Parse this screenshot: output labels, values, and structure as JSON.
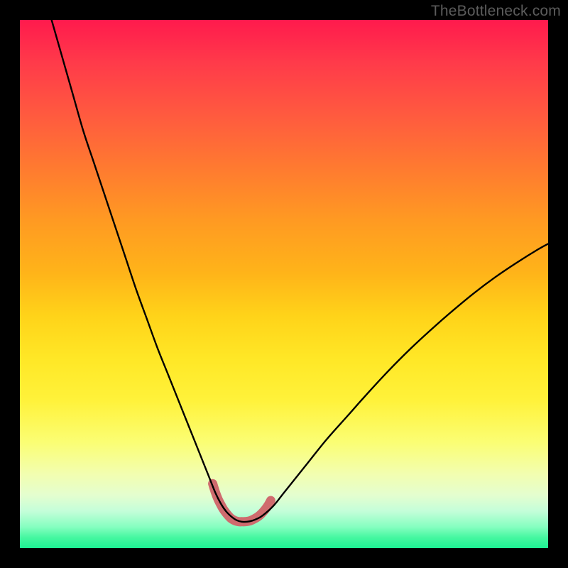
{
  "watermark": "TheBottleneck.com",
  "chart_data": {
    "type": "line",
    "title": "",
    "xlabel": "",
    "ylabel": "",
    "xlim": [
      0,
      100
    ],
    "ylim": [
      0,
      100
    ],
    "series": [
      {
        "name": "bottleneck-curve",
        "x": [
          6,
          8,
          10,
          12,
          14,
          16,
          18,
          20,
          22,
          24,
          26,
          28,
          30,
          32,
          33,
          34,
          35,
          36,
          37,
          38,
          39,
          40,
          41,
          42,
          43,
          44,
          45,
          46,
          48,
          50,
          54,
          58,
          62,
          66,
          70,
          74,
          78,
          82,
          86,
          90,
          94,
          98,
          100
        ],
        "y": [
          100,
          93,
          86,
          79,
          73,
          67,
          61,
          55,
          49,
          43.5,
          38,
          33,
          28,
          23,
          20.5,
          18,
          15.5,
          13,
          10.5,
          8.5,
          7,
          6,
          5.3,
          5,
          5,
          5.2,
          5.6,
          6.2,
          8,
          10.5,
          15.5,
          20.5,
          25,
          29.5,
          33.8,
          37.8,
          41.5,
          45,
          48.3,
          51.3,
          54,
          56.5,
          57.6
        ]
      },
      {
        "name": "trough-marker",
        "x": [
          36.5,
          37,
          37.5,
          38,
          38.5,
          39,
          39.5,
          40,
          40.5,
          41,
          41.5,
          42,
          42.5,
          43,
          43.5,
          44,
          44.5,
          45,
          45.5,
          46,
          46.5,
          47,
          47.5
        ],
        "y": [
          12.2,
          10.6,
          9.3,
          8.3,
          7.4,
          6.7,
          6.1,
          5.6,
          5.3,
          5.1,
          5.0,
          5.0,
          5.0,
          5.05,
          5.15,
          5.35,
          5.6,
          5.9,
          6.3,
          6.8,
          7.4,
          8.1,
          9.0
        ]
      }
    ],
    "colors": {
      "curve": "#000000",
      "marker": "#cf6b6e",
      "background_top": "#ff1a4d",
      "background_bottom": "#1df293"
    }
  }
}
